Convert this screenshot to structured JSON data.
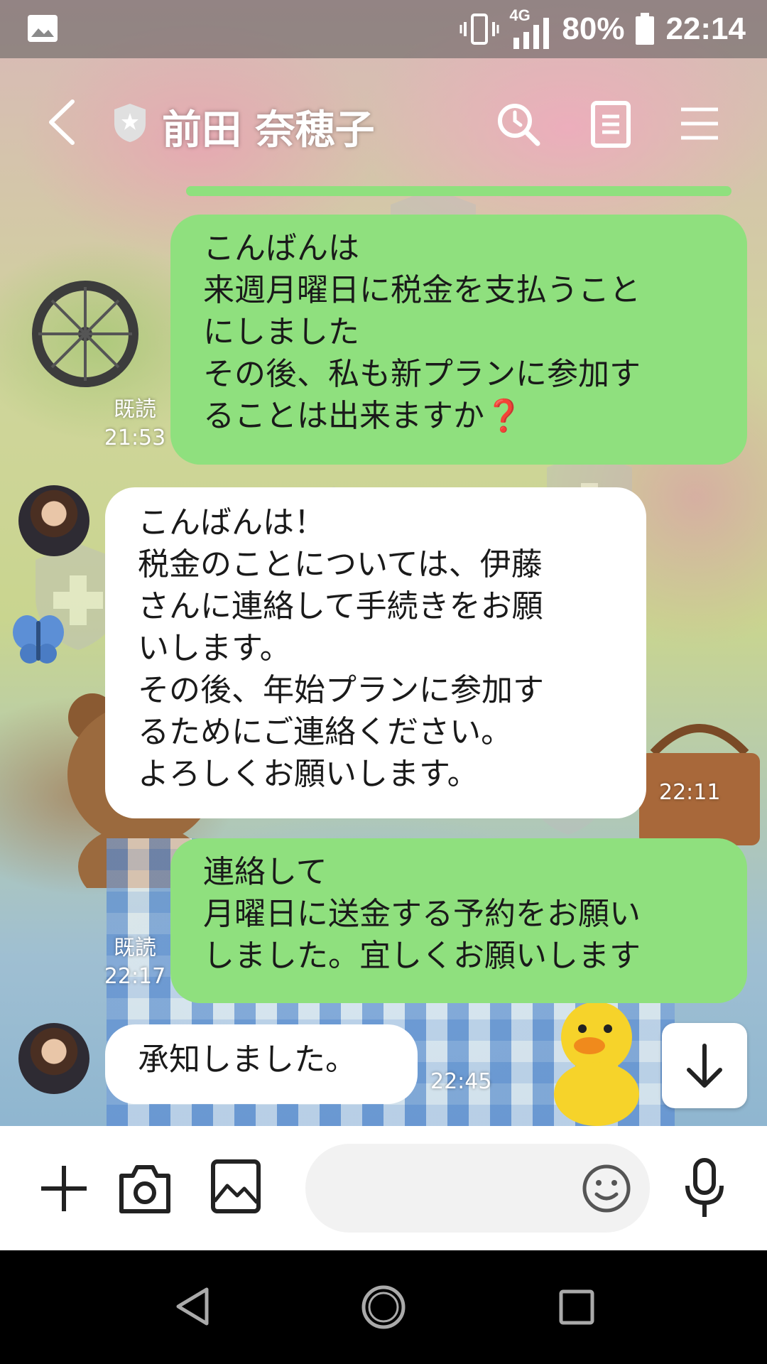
{
  "status_bar": {
    "network": "4G",
    "battery": "80%",
    "time": "22:14"
  },
  "header": {
    "title": "前田 奈穂子"
  },
  "messages": [
    {
      "sender": "me",
      "text": "こんばんは\n来週月曜日に税金を支払うこと\nにしました\nその後、私も新プランに参加す\nることは出来ますか❓",
      "read_label": "既読",
      "time": "21:53"
    },
    {
      "sender": "other",
      "text": "こんばんは！\n税金のことについては、伊藤\nさんに連絡して手続きをお願\nいします。\nその後、年始プランに参加す\nるためにご連絡ください。\nよろしくお願いします。",
      "time": "22:11"
    },
    {
      "sender": "me",
      "text": "連絡して\n月曜日に送金する予約をお願い\nしました。宜しくお願いします",
      "read_label": "既読",
      "time": "22:17"
    },
    {
      "sender": "other",
      "text": "承知しました。",
      "time": "22:45"
    }
  ],
  "input": {
    "placeholder": ""
  },
  "colors": {
    "my_bubble": "#8fe07e",
    "other_bubble": "#ffffff",
    "input_bar": "#ffffff",
    "nav_bar": "#000000"
  },
  "icons": {
    "status_left": "image-icon",
    "vibrate": "vibrate-icon",
    "signal": "signal-icon",
    "battery": "battery-icon",
    "back": "chevron-left-icon",
    "verified": "shield-star-icon",
    "search": "search-icon",
    "notes": "notes-icon",
    "menu": "hamburger-menu-icon",
    "scroll_down": "arrow-down-icon",
    "add": "plus-icon",
    "camera": "camera-icon",
    "gallery": "image-icon",
    "emoji": "smiley-icon",
    "mic": "microphone-icon",
    "nav_back": "triangle-back-icon",
    "nav_home": "circle-home-icon",
    "nav_recents": "square-recents-icon"
  }
}
